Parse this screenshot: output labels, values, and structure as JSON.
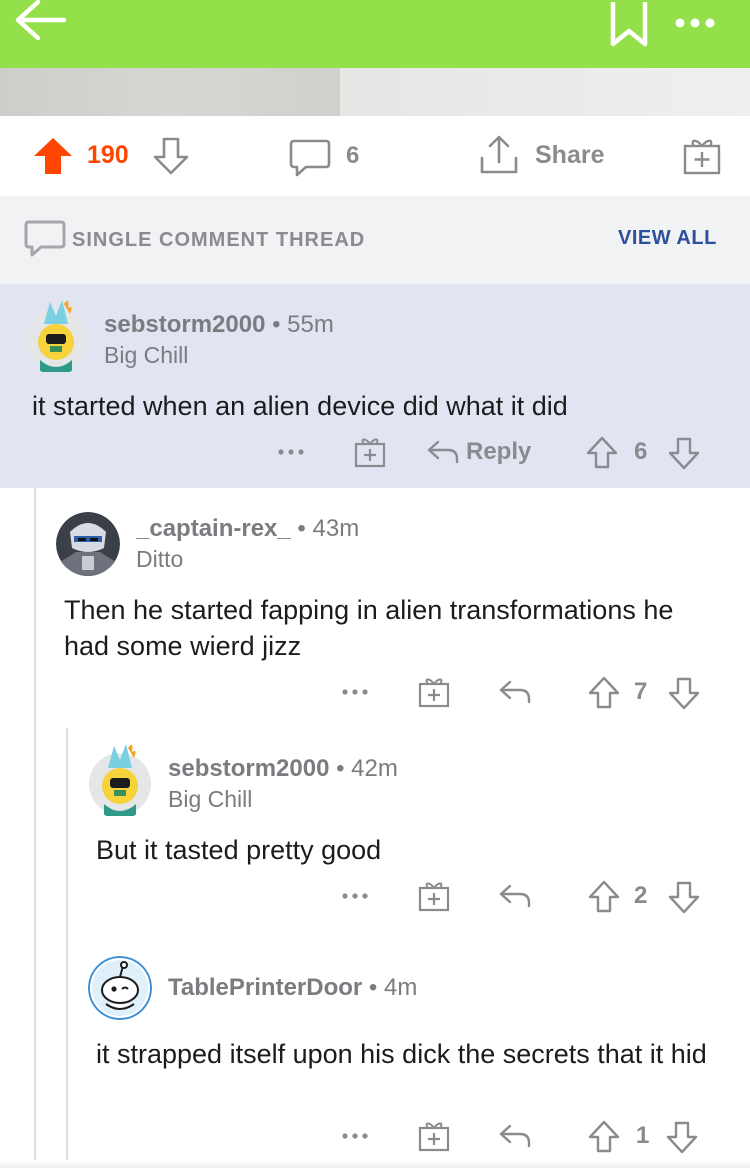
{
  "colors": {
    "topbar": "#94e04a",
    "upvote_active": "#ff4500",
    "vote_count_active": "#ff4500",
    "link_blue": "#2c4f9e",
    "muted": "#8b8b8f",
    "highlight_bg": "#e1e5f2"
  },
  "topbar": {
    "icons": [
      "back-arrow-icon",
      "bookmark-icon",
      "more-icon"
    ]
  },
  "post_actions": {
    "score": "190",
    "comments": "6",
    "share_label": "Share",
    "icons": [
      "upvote-icon",
      "downvote-icon",
      "comment-icon",
      "share-icon",
      "award-icon"
    ]
  },
  "thread_bar": {
    "label": "SINGLE COMMENT THREAD",
    "view_all": "VIEW ALL"
  },
  "comments": [
    {
      "username": "sebstorm2000",
      "time": "• 55m",
      "flair": "Big Chill",
      "text": "it started when an alien device did what it did",
      "reply_label": "Reply",
      "score": "6"
    },
    {
      "username": "_captain-rex_",
      "time": "• 43m",
      "flair": "Ditto",
      "text": "Then he started fapping in alien transformations he had some wierd jizz",
      "score": "7"
    },
    {
      "username": "sebstorm2000",
      "time": "• 42m",
      "flair": "Big Chill",
      "text": "But it tasted pretty good",
      "score": "2"
    },
    {
      "username": "TablePrinterDoor",
      "time": "• 4m",
      "flair": "",
      "text": "it strapped itself upon his dick the secrets that it hid",
      "score": "1"
    }
  ]
}
